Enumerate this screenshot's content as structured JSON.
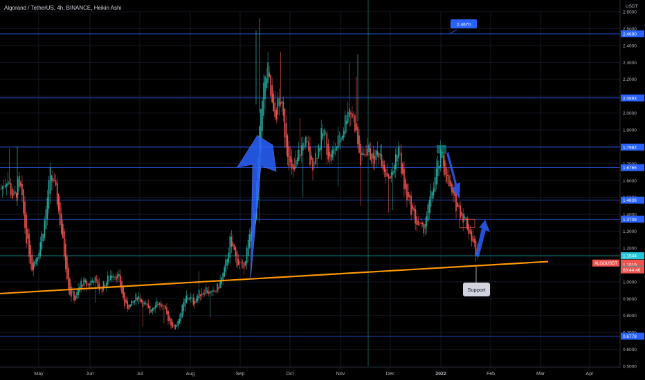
{
  "header": {
    "title": "Algorand / TetherUS, 4h, BINANCE, Heikin Ashi",
    "currency": "USDT"
  },
  "colors": {
    "background": "#000000",
    "up": "#26a69a",
    "down": "#ef5350",
    "hline": "#2962ff",
    "hline_cyan": "#26c6da",
    "trendline": "#ff9800",
    "arrow": "#2962ff",
    "callout": "#2962ff",
    "support_box": "#d1d4dc"
  },
  "chart_data": {
    "type": "candlestick",
    "y_axis": {
      "min": 0.5,
      "max": 2.6,
      "ticks": [
        "2.6000",
        "2.5000",
        "2.4000",
        "2.3000",
        "2.2000",
        "2.1000",
        "2.0000",
        "1.9000",
        "1.8000",
        "1.7000",
        "1.6000",
        "1.5000",
        "1.4000",
        "1.3000",
        "1.2000",
        "1.1000",
        "1.0000",
        "0.9000",
        "0.8000",
        "0.7000",
        "0.6000",
        "0.5000"
      ]
    },
    "x_axis": {
      "labels": [
        "May",
        "Jun",
        "Jul",
        "Aug",
        "Sep",
        "Oct",
        "Nov",
        "Dec",
        "2022",
        "Feb",
        "Mar",
        "Apr"
      ]
    },
    "horizontal_levels": [
      {
        "value": 2.469,
        "label": "2.4690",
        "color": "#2962ff"
      },
      {
        "value": 2.0893,
        "label": "2.0893",
        "color": "#2962ff"
      },
      {
        "value": 1.7982,
        "label": "1.7982",
        "color": "#2962ff"
      },
      {
        "value": 1.6765,
        "label": "1.6765",
        "color": "#2962ff"
      },
      {
        "value": 1.4836,
        "label": "1.4836",
        "color": "#2962ff"
      },
      {
        "value": 1.3708,
        "label": "1.3708",
        "color": "#2962ff"
      },
      {
        "value": 1.1544,
        "label": "1.1544",
        "color": "#26c6da"
      },
      {
        "value": 0.6778,
        "label": "0.6778",
        "color": "#2962ff"
      }
    ],
    "price_tags": [
      {
        "value": 1.1111,
        "label": "1.1111",
        "color": "#ef5350"
      },
      {
        "value": 1.1019,
        "label": "1.1019",
        "color": "#ef5350"
      },
      {
        "value": 1.0743,
        "label": "1.0743",
        "color": "#26a69a"
      }
    ],
    "symbol_tag": "ALGOUSDT",
    "countdown": "03:44:46",
    "callout_label": "2.4670",
    "support_label": "Support",
    "trendline": {
      "from": {
        "date": "Apr 2021",
        "price": 0.93
      },
      "to": {
        "date": "Mar 2022",
        "price": 1.12
      }
    },
    "price_path": [
      [
        0.0,
        1.55
      ],
      [
        0.01,
        1.62
      ],
      [
        0.02,
        1.48
      ],
      [
        0.03,
        1.6
      ],
      [
        0.04,
        1.28
      ],
      [
        0.05,
        1.08
      ],
      [
        0.06,
        1.18
      ],
      [
        0.07,
        1.35
      ],
      [
        0.08,
        1.66
      ],
      [
        0.09,
        1.5
      ],
      [
        0.1,
        1.22
      ],
      [
        0.11,
        0.94
      ],
      [
        0.12,
        0.9
      ],
      [
        0.13,
        1.0
      ],
      [
        0.14,
        0.98
      ],
      [
        0.15,
        1.02
      ],
      [
        0.16,
        0.95
      ],
      [
        0.17,
        1.0
      ],
      [
        0.18,
        1.06
      ],
      [
        0.19,
        1.02
      ],
      [
        0.2,
        0.85
      ],
      [
        0.21,
        0.86
      ],
      [
        0.22,
        0.92
      ],
      [
        0.23,
        0.87
      ],
      [
        0.24,
        0.82
      ],
      [
        0.25,
        0.89
      ],
      [
        0.26,
        0.85
      ],
      [
        0.27,
        0.78
      ],
      [
        0.28,
        0.72
      ],
      [
        0.29,
        0.82
      ],
      [
        0.3,
        0.92
      ],
      [
        0.31,
        0.88
      ],
      [
        0.32,
        0.93
      ],
      [
        0.33,
        0.96
      ],
      [
        0.34,
        0.92
      ],
      [
        0.35,
        0.97
      ],
      [
        0.36,
        1.06
      ],
      [
        0.37,
        1.26
      ],
      [
        0.38,
        1.12
      ],
      [
        0.39,
        1.08
      ],
      [
        0.4,
        1.25
      ],
      [
        0.41,
        1.4
      ],
      [
        0.42,
        2.1
      ],
      [
        0.43,
        2.25
      ],
      [
        0.44,
        1.95
      ],
      [
        0.45,
        2.1
      ],
      [
        0.46,
        1.82
      ],
      [
        0.47,
        1.62
      ],
      [
        0.48,
        1.75
      ],
      [
        0.49,
        1.85
      ],
      [
        0.5,
        1.68
      ],
      [
        0.51,
        1.78
      ],
      [
        0.52,
        1.9
      ],
      [
        0.53,
        1.72
      ],
      [
        0.54,
        1.8
      ],
      [
        0.55,
        1.88
      ],
      [
        0.56,
        2.05
      ],
      [
        0.57,
        1.95
      ],
      [
        0.58,
        1.7
      ],
      [
        0.59,
        1.8
      ],
      [
        0.6,
        1.72
      ],
      [
        0.61,
        1.78
      ],
      [
        0.62,
        1.65
      ],
      [
        0.63,
        1.62
      ],
      [
        0.64,
        1.82
      ],
      [
        0.65,
        1.55
      ],
      [
        0.66,
        1.45
      ],
      [
        0.67,
        1.35
      ],
      [
        0.68,
        1.3
      ],
      [
        0.69,
        1.45
      ],
      [
        0.7,
        1.62
      ],
      [
        0.71,
        1.75
      ],
      [
        0.72,
        1.6
      ],
      [
        0.73,
        1.48
      ],
      [
        0.74,
        1.42
      ],
      [
        0.75,
        1.35
      ],
      [
        0.76,
        1.25
      ],
      [
        0.77,
        1.12
      ]
    ]
  }
}
